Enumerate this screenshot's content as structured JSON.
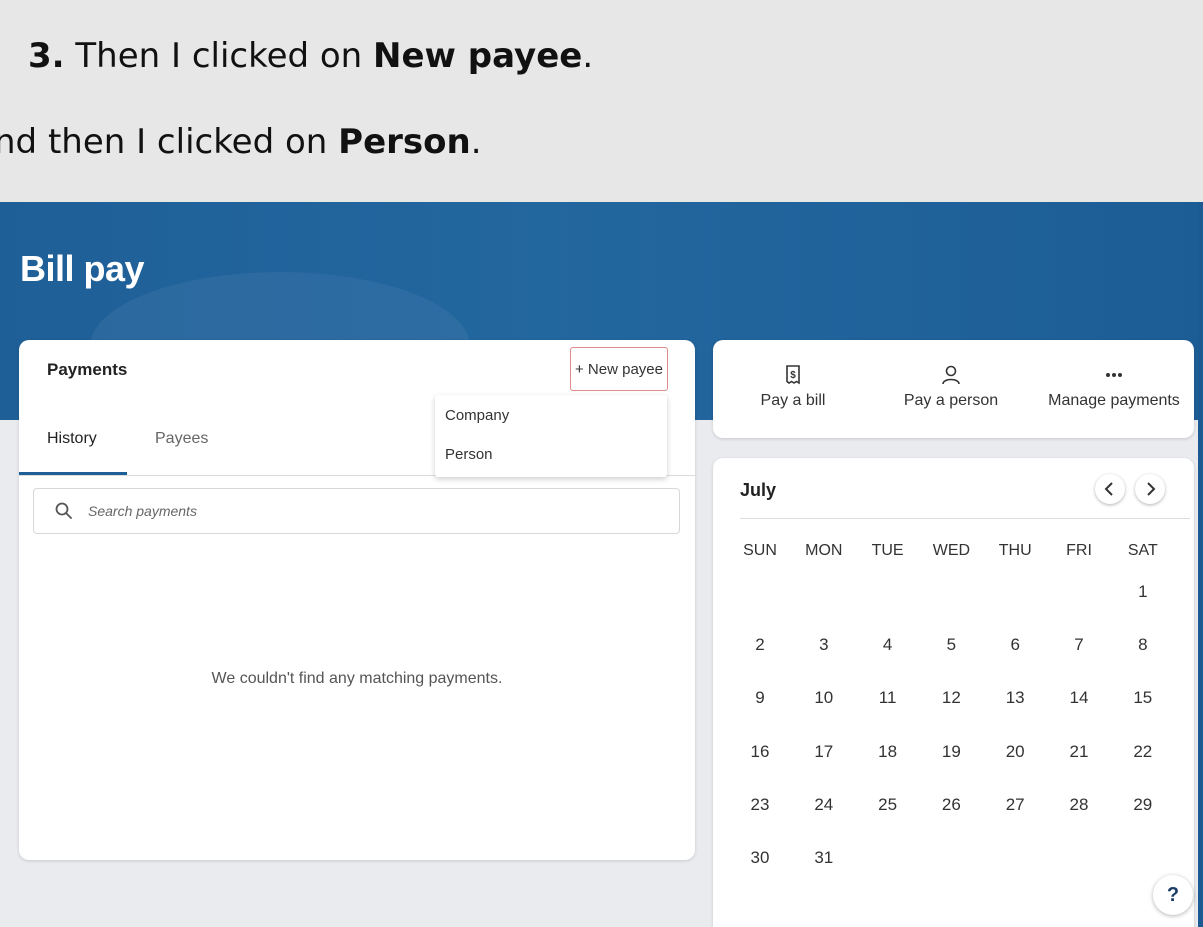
{
  "instructions": {
    "line1": {
      "number": "3.",
      "text": " Then I clicked on ",
      "bold": "New payee",
      "end": "."
    },
    "line2": {
      "text": "nd then I clicked on ",
      "bold": "Person",
      "end": "."
    }
  },
  "app": {
    "title": "Bill pay"
  },
  "payments": {
    "title": "Payments",
    "new_payee_label": "+ New payee",
    "tabs": [
      {
        "label": "History"
      },
      {
        "label": "Payees"
      }
    ],
    "search_placeholder": "Search payments",
    "empty_message": "We couldn't find any matching payments."
  },
  "dropdown": {
    "items": [
      {
        "label": "Company"
      },
      {
        "label": "Person"
      }
    ]
  },
  "actions": [
    {
      "label": "Pay a bill",
      "icon": "receipt-dollar-icon"
    },
    {
      "label": "Pay a person",
      "icon": "person-icon"
    },
    {
      "label": "Manage payments",
      "icon": "more-dots-icon"
    }
  ],
  "calendar": {
    "month": "July",
    "weekdays": [
      "SUN",
      "MON",
      "TUE",
      "WED",
      "THU",
      "FRI",
      "SAT"
    ],
    "first_weekday_index": 6,
    "days_in_month": 31
  },
  "help_label": "?",
  "colors": {
    "banner": "#1f5f98",
    "accent": "#1f5f98",
    "new_payee_border": "#e08b8b"
  }
}
